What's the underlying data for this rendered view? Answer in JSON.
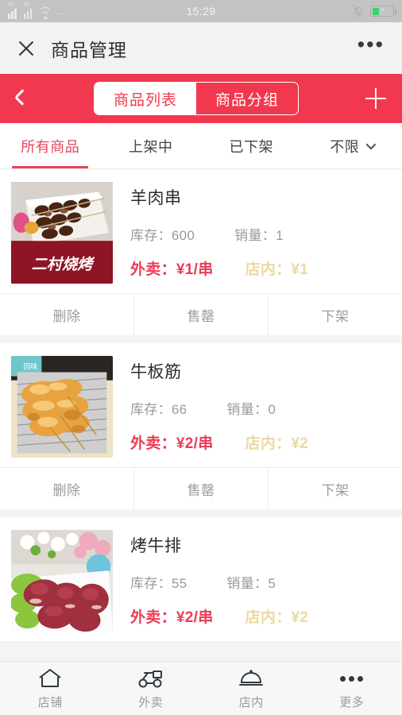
{
  "statusbar": {
    "time": "15:29",
    "signal1_label": "4G",
    "signal2_label": "3G",
    "overflow_dots": "···",
    "bolt": "⚡",
    "icons": [
      "signal-4g-icon",
      "signal-3g-icon",
      "wifi-icon",
      "bell-muted-icon",
      "battery-charging-icon"
    ]
  },
  "titlebar": {
    "close_label": "✕",
    "title": "商品管理",
    "more_label": "•••"
  },
  "navbar": {
    "back_label": "‹",
    "add_label": "+",
    "accent_color": "#f2384e",
    "segments": [
      {
        "label": "商品列表",
        "active": true
      },
      {
        "label": "商品分组",
        "active": false
      }
    ]
  },
  "filter_tabs": {
    "active_color": "#e5465c",
    "items": [
      {
        "label": "所有商品",
        "active": true,
        "has_caret": false
      },
      {
        "label": "上架中",
        "active": false,
        "has_caret": false
      },
      {
        "label": "已下架",
        "active": false,
        "has_caret": false
      },
      {
        "label": "不限",
        "active": false,
        "has_caret": true
      }
    ]
  },
  "labels": {
    "stock_prefix": "库存：",
    "sales_prefix": "销量：",
    "takeout_prefix": "外卖：",
    "instore_prefix": "店内：",
    "takeout_color": "#ec3b56",
    "instore_color": "#ecd9a0"
  },
  "actions": {
    "delete": "删除",
    "sold_out": "售罄",
    "unlist": "下架"
  },
  "products": [
    {
      "name": "羊肉串",
      "stock": "600",
      "sales": "1",
      "takeout_price": "¥1/串",
      "instore_price": "¥1",
      "thumb": "lamb-skewers-photo"
    },
    {
      "name": "牛板筋",
      "stock": "66",
      "sales": "0",
      "takeout_price": "¥2/串",
      "instore_price": "¥2",
      "thumb": "grilled-beef-tendon-photo"
    },
    {
      "name": "烤牛排",
      "stock": "55",
      "sales": "5",
      "takeout_price": "¥2/串",
      "instore_price": "¥2",
      "thumb": "raw-beef-steak-photo"
    }
  ],
  "tabbar": {
    "items": [
      {
        "label": "店铺",
        "icon": "house-icon"
      },
      {
        "label": "外卖",
        "icon": "scooter-icon"
      },
      {
        "label": "店内",
        "icon": "food-cloche-icon"
      },
      {
        "label": "更多",
        "icon": "more-dots-icon"
      }
    ]
  }
}
